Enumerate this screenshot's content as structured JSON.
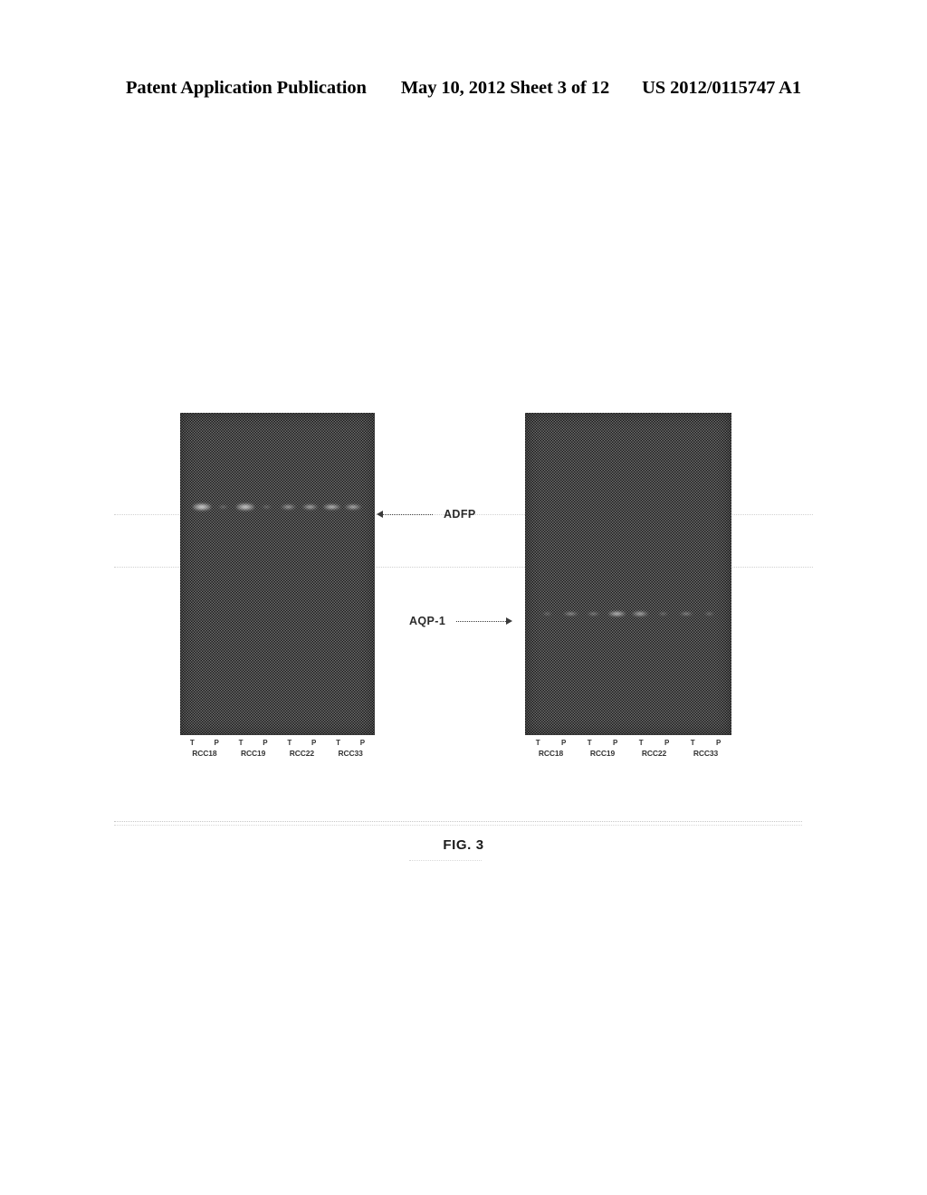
{
  "header": {
    "publication": "Patent Application Publication",
    "date_sheet": "May 10, 2012  Sheet 3 of 12",
    "publication_number": "US 2012/0115747 A1"
  },
  "figure": {
    "caption": "FIG. 3",
    "analytes": [
      {
        "id": "adfp",
        "label": "ADFP",
        "arrow_direction": "left",
        "points_to": "left-gel"
      },
      {
        "id": "aqp1",
        "label": "AQP-1",
        "arrow_direction": "right",
        "points_to": "right-gel"
      }
    ],
    "panels": [
      {
        "id": "left-gel",
        "name": "adfp-western-blot",
        "lane_pair_labels": [
          "T",
          "P"
        ],
        "samples": [
          "RCC18",
          "RCC19",
          "RCC22",
          "RCC33"
        ]
      },
      {
        "id": "right-gel",
        "name": "aqp1-western-blot",
        "lane_pair_labels": [
          "T",
          "P"
        ],
        "samples": [
          "RCC18",
          "RCC19",
          "RCC22",
          "RCC33"
        ]
      }
    ]
  },
  "chart_data": {
    "type": "heatmap",
    "title": "FIG. 3",
    "xlabel": "",
    "ylabel": "",
    "grid": false,
    "legend_position": "none",
    "description": "Two Western blot gel panels. Left panel probed for ADFP, right panel probed for AQP-1. Each panel has 8 lanes arranged as 4 tumor (T) / plasma or paired (P) couples for samples RCC18, RCC19, RCC22 and RCC33. Band intensity is reported on a 0-1 relative scale.",
    "panels": [
      {
        "id": "left-gel",
        "probe": "ADFP",
        "band_row_label": "ADFP",
        "categories": [
          "RCC18 T",
          "RCC18 P",
          "RCC19 T",
          "RCC19 P",
          "RCC22 T",
          "RCC22 P",
          "RCC33 T",
          "RCC33 P"
        ],
        "values": [
          0.85,
          0.12,
          0.8,
          0.1,
          0.45,
          0.55,
          0.7,
          0.6
        ]
      },
      {
        "id": "right-gel",
        "probe": "AQP-1",
        "band_row_label": "AQP-1",
        "categories": [
          "RCC18 T",
          "RCC18 P",
          "RCC19 T",
          "RCC19 P",
          "RCC22 T",
          "RCC22 P",
          "RCC33 T",
          "RCC33 P"
        ],
        "values": [
          0.1,
          0.45,
          0.3,
          0.7,
          0.55,
          0.12,
          0.35,
          0.15
        ]
      }
    ],
    "colors": {
      "gel_background": "#4a4a4a",
      "band": "#f2f2f2",
      "text": "#000000"
    }
  }
}
